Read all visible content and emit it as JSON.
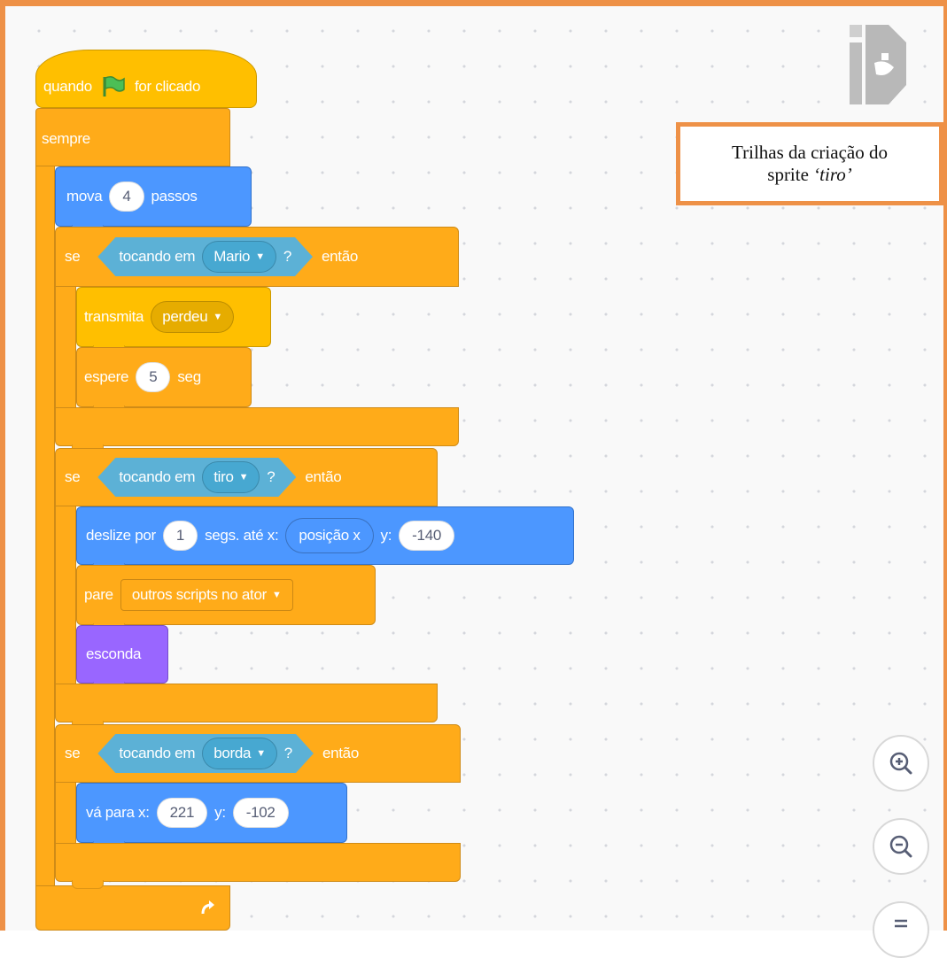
{
  "note": {
    "line1": "Trilhas da criação do",
    "line2_prefix": "sprite ",
    "line2_italic": "‘tiro’"
  },
  "hat": {
    "label_before": "quando",
    "label_after": "for clicado",
    "flag_icon": "green-flag-icon"
  },
  "forever": {
    "label": "sempre"
  },
  "move": {
    "label": "mova",
    "value": "4",
    "unit": "passos"
  },
  "if1": {
    "label": "se",
    "sensor": "tocando em",
    "target": "Mario",
    "q": "?",
    "then": "então"
  },
  "broadcast": {
    "label": "transmita",
    "message": "perdeu"
  },
  "wait": {
    "label": "espere",
    "value": "5",
    "unit": "seg"
  },
  "if2": {
    "label": "se",
    "sensor": "tocando em",
    "target": "tiro",
    "q": "?",
    "then": "então"
  },
  "glide": {
    "label": "deslize por",
    "secs": "1",
    "mid": "segs. até x:",
    "x_reporter": "posição x",
    "y_label": "y:",
    "y": "-140"
  },
  "stop": {
    "label": "pare",
    "option": "outros scripts no ator"
  },
  "hide": {
    "label": "esconda"
  },
  "if3": {
    "label": "se",
    "sensor": "tocando em",
    "target": "borda",
    "q": "?",
    "then": "então"
  },
  "goto": {
    "label": "vá para x:",
    "x": "221",
    "y_label": "y:",
    "y": "-102"
  },
  "colors": {
    "control": "#ffab19",
    "events": "#ffbf00",
    "motion": "#4c97ff",
    "sensing": "#5cb1d6",
    "looks": "#9966ff",
    "frame": "#ee9147"
  }
}
